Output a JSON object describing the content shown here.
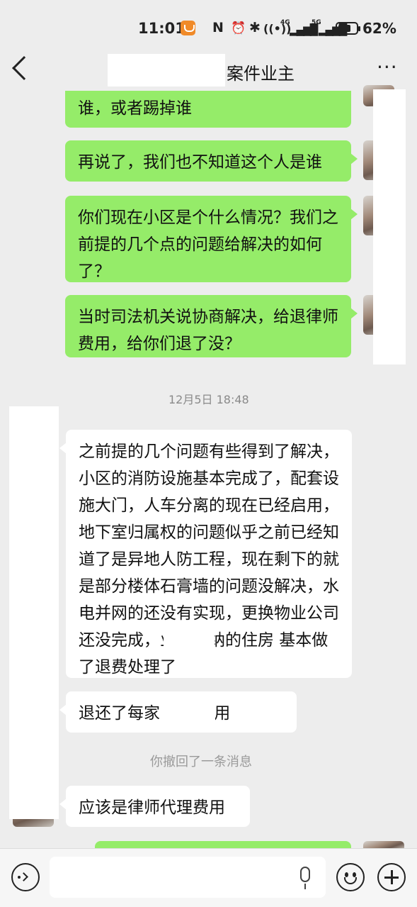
{
  "status_bar": {
    "time": "11:01",
    "signal_1": "4G",
    "signal_2": "5G",
    "battery": "62%",
    "nfc": "N",
    "bluetooth": "✱"
  },
  "header": {
    "title": "案件业主"
  },
  "messages": [
    {
      "side": "right",
      "text": "谁，或者踢掉谁"
    },
    {
      "side": "right",
      "text": "再说了，我们也不知道这个人是谁"
    },
    {
      "side": "right",
      "text": "你们现在小区是个什么情况？我们之前提的几个点的问题给解决的如何了？"
    },
    {
      "side": "right",
      "text": "当时司法机关说协商解决，给退律师费用，给你们退了没？"
    },
    {
      "type": "timestamp",
      "text": "12月5日 18:48"
    },
    {
      "side": "left",
      "text": "之前提的几个问题有些得到了解决，小区的消防设施基本完成了，配套设施大门，人车分离的现在已经启用，地下室归属权的问题似乎之前已经知道了是异地人防工程，现在剩下的就是部分楼体石膏墙的问题没解决，水电并网的还没有实现，更换物业公司还没完成，业主缴纳的住房  基本做了退费处理了"
    },
    {
      "side": "left",
      "text": "退还了每家  元的费用"
    },
    {
      "type": "system",
      "text": "你撤回了一条消息"
    },
    {
      "side": "left",
      "text": "应该是律师代理费用"
    }
  ],
  "input": {
    "placeholder": ""
  }
}
